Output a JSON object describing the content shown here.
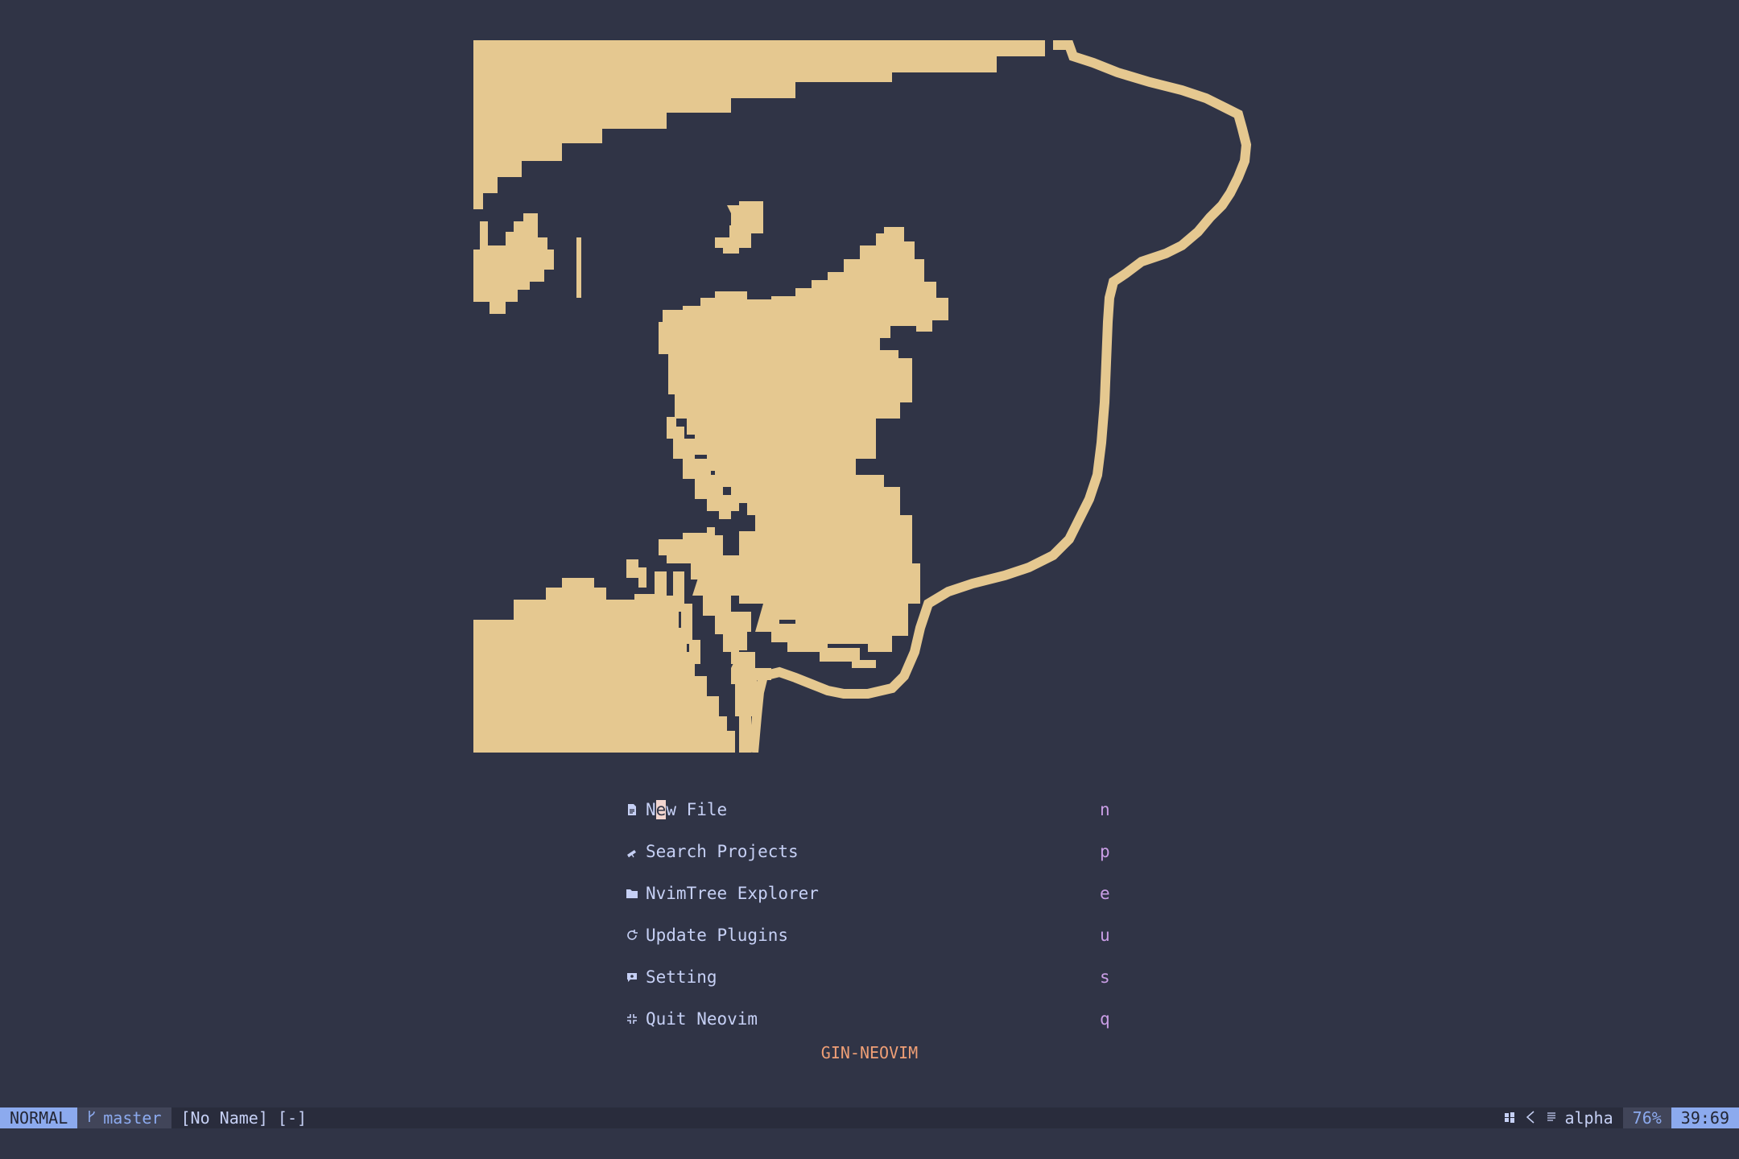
{
  "colors": {
    "background": "#303446",
    "art": "#e5c890",
    "text": "#c6d0f5",
    "key": "#ca9ee6",
    "footer": "#ef9f76",
    "mode_bg": "#8caaee"
  },
  "dashboard": {
    "menu": [
      {
        "icon": "file-icon",
        "label_first": "N",
        "label_cursor": "e",
        "label_rest": "w File",
        "key": "n"
      },
      {
        "icon": "telescope-icon",
        "label": "Search Projects",
        "key": "p"
      },
      {
        "icon": "folder-icon",
        "label": "NvimTree Explorer",
        "key": "e"
      },
      {
        "icon": "refresh-icon",
        "label": "Update Plugins",
        "key": "u"
      },
      {
        "icon": "settings-icon",
        "label": "Setting",
        "key": "s"
      },
      {
        "icon": "quit-icon",
        "label": "Quit Neovim",
        "key": "q"
      }
    ],
    "footer": "GIN-NEOVIM"
  },
  "statusline": {
    "mode": "NORMAL",
    "branch": "master",
    "file": "[No Name] [-]",
    "filetype": "alpha",
    "percent": "76%",
    "position": "39:69"
  }
}
